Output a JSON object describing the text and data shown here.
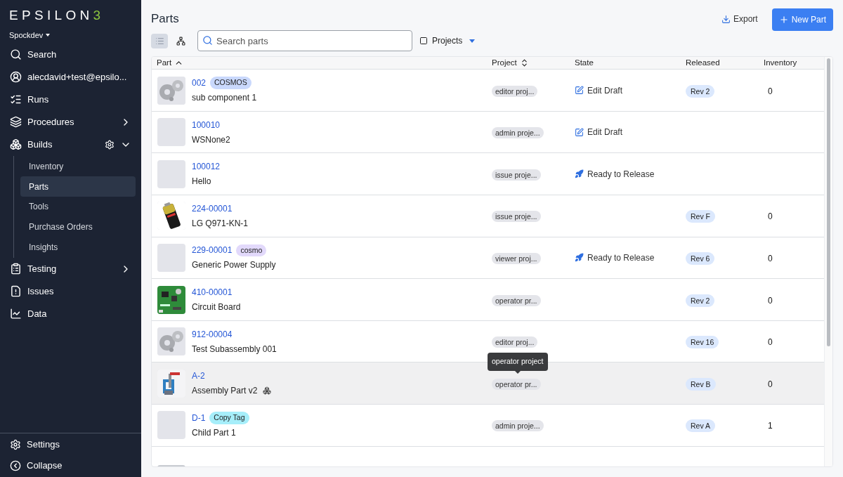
{
  "sidebar": {
    "logo": {
      "main": "EPSILON",
      "accent": "3"
    },
    "workspace": "Spockdev",
    "items": [
      {
        "label": "Search",
        "selected": false
      },
      {
        "label": "alecdavid+test@epsilo...",
        "selected": false
      },
      {
        "label": "Runs",
        "selected": false
      },
      {
        "label": "Procedures",
        "selected": false,
        "expanded": false
      },
      {
        "label": "Builds",
        "selected": false,
        "expanded": true,
        "children": [
          {
            "label": "Inventory",
            "selected": false
          },
          {
            "label": "Parts",
            "selected": true
          },
          {
            "label": "Tools",
            "selected": false
          },
          {
            "label": "Purchase Orders",
            "selected": false
          },
          {
            "label": "Insights",
            "selected": false
          }
        ]
      },
      {
        "label": "Testing",
        "selected": false,
        "expanded": false
      },
      {
        "label": "Issues",
        "selected": false
      },
      {
        "label": "Data",
        "selected": false
      }
    ],
    "footer": [
      {
        "label": "Settings"
      },
      {
        "label": "Collapse"
      }
    ]
  },
  "page": {
    "title": "Parts",
    "export": "Export",
    "new_part": "New Part"
  },
  "toolbar": {
    "views": [
      {
        "kind": "list",
        "selected": true
      },
      {
        "kind": "tree",
        "selected": false
      }
    ],
    "search": {
      "placeholder": "Search parts"
    },
    "projects_filter": {
      "label": "Projects",
      "checked": false
    }
  },
  "table": {
    "columns": [
      {
        "label": "Part",
        "sortable": true,
        "sorted": true
      },
      {
        "label": "Project",
        "sortable": true,
        "sorted": false
      },
      {
        "label": "State",
        "sortable": false,
        "sorted": false
      },
      {
        "label": "Released",
        "sortable": false,
        "sorted": false
      },
      {
        "label": "Inventory",
        "sortable": false,
        "sorted": false
      }
    ],
    "rows": [
      {
        "number": "002",
        "tag": {
          "label": "COSMOS",
          "color": "#c9d8fc"
        },
        "name": "sub component 1",
        "assembly": false,
        "project": "editor proj...",
        "state": {
          "kind": "draft",
          "label": "Edit Draft"
        },
        "released": "Rev 2",
        "inventory": "0",
        "highlighted": false
      },
      {
        "number": "100010",
        "name": "WSNone2",
        "assembly": false,
        "thumb": {
          "kind": "blank"
        },
        "project": "admin proje...",
        "state": {
          "kind": "draft",
          "label": "Edit Draft"
        },
        "highlighted": false
      },
      {
        "number": "100012",
        "name": "Hello",
        "assembly": false,
        "thumb": {
          "kind": "blank"
        },
        "project": "issue proje...",
        "state": {
          "kind": "ready",
          "label": "Ready to Release"
        },
        "highlighted": false
      },
      {
        "number": "224-00001",
        "name": "LG Q971-KN-1",
        "assembly": false,
        "project": "issue proje...",
        "released": "Rev F",
        "inventory": "0",
        "highlighted": false
      },
      {
        "number": "229-00001",
        "tag": {
          "label": "cosmo",
          "color": "#e2d9fb"
        },
        "name": "Generic Power Supply",
        "assembly": false,
        "thumb": {
          "kind": "blank"
        },
        "project": "viewer proj...",
        "state": {
          "kind": "ready",
          "label": "Ready to Release"
        },
        "released": "Rev 6",
        "inventory": "0",
        "highlighted": false
      },
      {
        "number": "410-00001",
        "name": "Circuit Board",
        "assembly": false,
        "project": "operator pr...",
        "released": "Rev 2",
        "inventory": "0",
        "highlighted": false
      },
      {
        "number": "912-00004",
        "name": "Test Subassembly 001",
        "assembly": false,
        "project": "editor proj...",
        "released": "Rev 16",
        "inventory": "0",
        "highlighted": false
      },
      {
        "number": "A-2",
        "name": "Assembly Part v2",
        "assembly": true,
        "project": "operator pr...",
        "released": "Rev B",
        "inventory": "0",
        "highlighted": true
      },
      {
        "number": "D-1",
        "tag": {
          "label": "Copy Tag",
          "color": "#a6eefa"
        },
        "name": "Child Part 1",
        "assembly": false,
        "thumb": {
          "kind": "blank"
        },
        "project": "admin proje...",
        "released": "Rev A",
        "inventory": "1",
        "highlighted": false
      }
    ],
    "tooltip": "operator project"
  }
}
